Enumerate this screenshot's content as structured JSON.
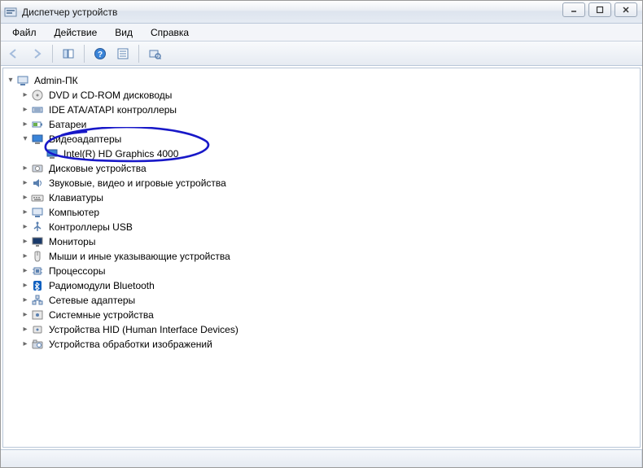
{
  "window": {
    "title": "Диспетчер устройств"
  },
  "menu": {
    "file": "Файл",
    "action": "Действие",
    "view": "Вид",
    "help": "Справка"
  },
  "tree": {
    "root": "Admin-ПК",
    "items": [
      {
        "label": "DVD и CD-ROM дисководы",
        "icon": "disc"
      },
      {
        "label": "IDE ATA/ATAPI контроллеры",
        "icon": "ide"
      },
      {
        "label": "Батареи",
        "icon": "battery"
      },
      {
        "label": "Видеоадаптеры",
        "icon": "display",
        "expanded": true,
        "children": [
          {
            "label": "Intel(R) HD Graphics 4000",
            "icon": "display"
          }
        ]
      },
      {
        "label": "Дисковые устройства",
        "icon": "disk"
      },
      {
        "label": "Звуковые, видео и игровые устройства",
        "icon": "sound"
      },
      {
        "label": "Клавиатуры",
        "icon": "keyboard"
      },
      {
        "label": "Компьютер",
        "icon": "computer"
      },
      {
        "label": "Контроллеры USB",
        "icon": "usb"
      },
      {
        "label": "Мониторы",
        "icon": "monitor"
      },
      {
        "label": "Мыши и иные указывающие устройства",
        "icon": "mouse"
      },
      {
        "label": "Процессоры",
        "icon": "cpu"
      },
      {
        "label": "Радиомодули Bluetooth",
        "icon": "bluetooth"
      },
      {
        "label": "Сетевые адаптеры",
        "icon": "network"
      },
      {
        "label": "Системные устройства",
        "icon": "system"
      },
      {
        "label": "Устройства HID (Human Interface Devices)",
        "icon": "hid"
      },
      {
        "label": "Устройства обработки изображений",
        "icon": "imaging"
      }
    ]
  }
}
